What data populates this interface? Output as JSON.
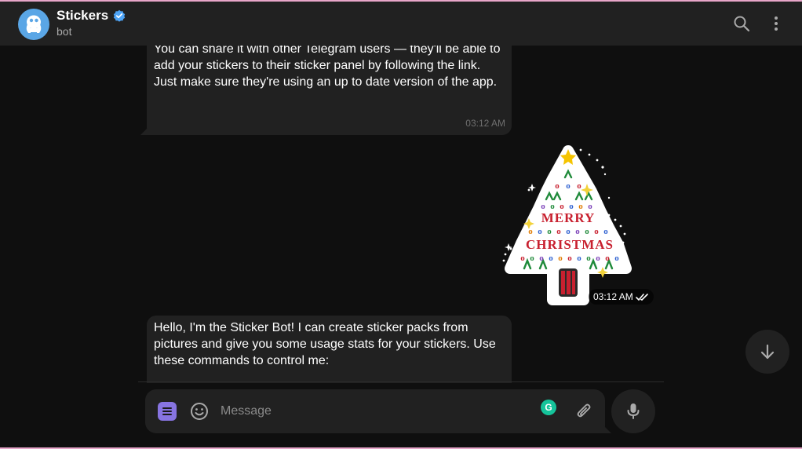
{
  "header": {
    "title": "Stickers",
    "subtitle": "bot",
    "verified": true,
    "icons": [
      "search-icon",
      "more-vertical-icon"
    ]
  },
  "messages": [
    {
      "type": "text",
      "text": "You can share it with other Telegram users — they'll be able to\nadd your stickers to their sticker panel by following the link.\nJust make sure they're using an up to date version of the app.",
      "time": "03:12 AM"
    },
    {
      "type": "sticker",
      "sticker_name": "merry-christmas-tree",
      "sticker_text": [
        "MERRY",
        "CHRISTMAS"
      ],
      "time": "03:12 AM",
      "status": "read"
    },
    {
      "type": "text",
      "text": "Hello, I'm the Sticker Bot! I can create sticker packs from\npictures and give you some usage stats for your stickers. Use\nthese commands to control me:"
    }
  ],
  "composer": {
    "placeholder": "Message",
    "value": "",
    "grammarly_label": "G"
  },
  "colors": {
    "background": "#0f0f0f",
    "bubble": "#212121",
    "accent": "#8774e1",
    "avatar": "#5aa6e6",
    "verified": "#4ea4f6"
  }
}
